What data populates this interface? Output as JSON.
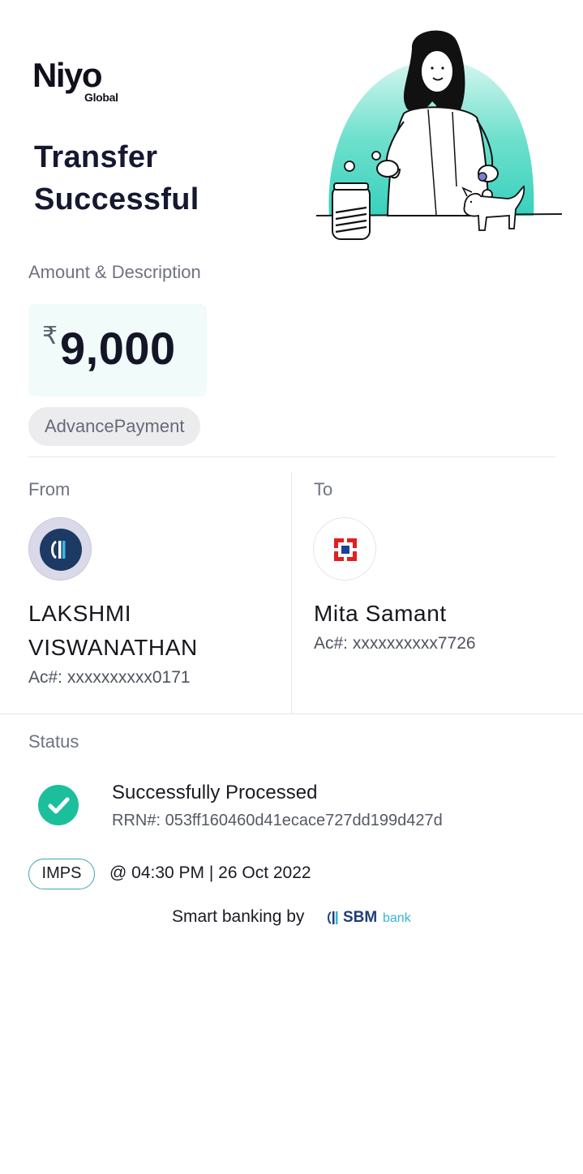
{
  "brand": {
    "logo_main": "Niyo",
    "logo_sub": "Global"
  },
  "header": {
    "title_line1": "Transfer",
    "title_line2": "Successful"
  },
  "amount_section": {
    "label": "Amount & Description",
    "currency_symbol": "₹",
    "amount": "9,000",
    "description": "AdvancePayment"
  },
  "from": {
    "label": "From",
    "name_line1": "LAKSHMI",
    "name_line2": "VISWANATHAN",
    "account": "Ac#: xxxxxxxxxx0171",
    "avatar_icon": "sbm-bank-logo-icon"
  },
  "to": {
    "label": "To",
    "name": "Mita Samant",
    "account": "Ac#: xxxxxxxxxx7726",
    "avatar_icon": "hdfc-bank-logo-icon"
  },
  "status": {
    "label": "Status",
    "title": "Successfully Processed",
    "rrn": "RRN#: 053ff160460d41ecace727dd199d427d",
    "icon": "check-circle-icon"
  },
  "transfer": {
    "mode": "IMPS",
    "datetime": "@ 04:30 PM | 26 Oct 2022"
  },
  "footer": {
    "smart_banking": "Smart banking by",
    "sbm": "SBM",
    "bank": "bank"
  },
  "colors": {
    "accent_teal": "#1cbf9c",
    "amount_bg": "#f1fbfa",
    "sbm_blue": "#1d3f78",
    "hdfc_red": "#e0201f"
  }
}
